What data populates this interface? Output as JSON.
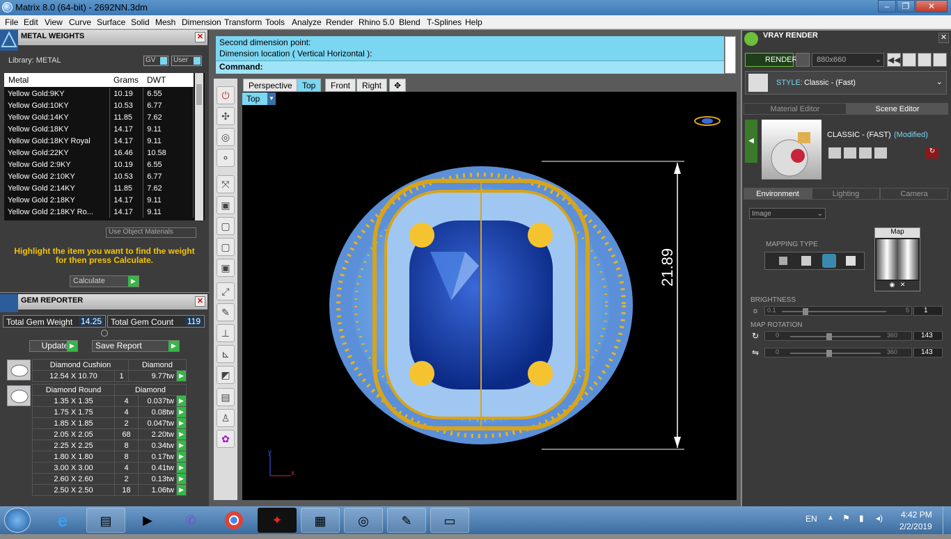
{
  "window": {
    "title": "Matrix 8.0 (64-bit) - 2692NN.3dm",
    "min": "–",
    "max": "❐",
    "close": "✕"
  },
  "menu": [
    "File",
    "Edit",
    "View",
    "Curve",
    "Surface",
    "Solid",
    "Mesh",
    "Dimension",
    "Transform",
    "Tools",
    "Analyze",
    "Render",
    "Rhino 5.0",
    "Blend",
    "T-Splines",
    "Help"
  ],
  "metal": {
    "header": "METAL WEIGHTS",
    "library": "Library: METAL",
    "gv": "GV",
    "user": "User",
    "columns": [
      "Metal",
      "Grams",
      "DWT"
    ],
    "rows": [
      [
        "Yellow Gold:9KY",
        "10.19",
        "6.55"
      ],
      [
        "Yellow Gold:10KY",
        "10.53",
        "6.77"
      ],
      [
        "Yellow Gold:14KY",
        "11.85",
        "7.62"
      ],
      [
        "Yellow Gold:18KY",
        "14.17",
        "9.11"
      ],
      [
        "Yellow Gold:18KY Royal",
        "14.17",
        "9.11"
      ],
      [
        "Yellow Gold:22KY",
        "16.46",
        "10.58"
      ],
      [
        "Yellow Gold 2:9KY",
        "10.19",
        "6.55"
      ],
      [
        "Yellow Gold 2:10KY",
        "10.53",
        "6.77"
      ],
      [
        "Yellow Gold 2:14KY",
        "11.85",
        "7.62"
      ],
      [
        "Yellow Gold 2:18KY",
        "14.17",
        "9.11"
      ],
      [
        "Yellow Gold 2:18KY Ro...",
        "14.17",
        "9.11"
      ]
    ],
    "use_object_materials": "Use Object Materials",
    "hint": "Highlight the item you want to find the weight for then press Calculate.",
    "calculate": "Calculate"
  },
  "gem": {
    "header": "GEM REPORTER",
    "total_weight_label": "Total Gem Weight",
    "total_weight": "14.25",
    "total_count_label": "Total Gem Count",
    "total_count": "119",
    "update": "Update",
    "save_report": "Save Report",
    "cushion": {
      "shape": "Diamond Cushion",
      "type": "Diamond",
      "size": "12.54 X 10.70",
      "count": "1",
      "weight": "9.77tw"
    },
    "round": {
      "shape": "Diamond Round",
      "type": "Diamond",
      "rows": [
        [
          "1.35 X 1.35",
          "4",
          "0.037tw"
        ],
        [
          "1.75 X 1.75",
          "4",
          "0.08tw"
        ],
        [
          "1.85 X 1.85",
          "2",
          "0.047tw"
        ],
        [
          "2.05 X 2.05",
          "68",
          "2.20tw"
        ],
        [
          "2.25 X 2.25",
          "8",
          "0.34tw"
        ],
        [
          "1.80 X 1.80",
          "8",
          "0.17tw"
        ],
        [
          "3.00 X 3.00",
          "4",
          "0.41tw"
        ],
        [
          "2.60 X 2.60",
          "2",
          "0.13tw"
        ],
        [
          "2.50 X 2.50",
          "18",
          "1.06tw"
        ]
      ]
    }
  },
  "command": {
    "line1": "Second dimension point:",
    "line2": "Dimension location ( Vertical  Horizontal ):",
    "prompt": "Command:"
  },
  "viewport": {
    "tabs": [
      "Perspective",
      "Top",
      "Front",
      "Right"
    ],
    "active_tab": "Top",
    "label": "Top",
    "dimension": "21.89",
    "axis_x": "x",
    "axis_y": "y"
  },
  "vray": {
    "header": "VRAY RENDER",
    "render": "RENDER",
    "resolution": "880x660",
    "style_label": "STYLE:",
    "style_value": "Classic - (Fast)",
    "tab_material": "Material Editor",
    "tab_scene": "Scene Editor",
    "preset": "CLASSIC - (FAST)",
    "modified": "(Modified)",
    "tab_env": "Environment",
    "tab_light": "Lighting",
    "tab_camera": "Camera",
    "env_type": "Image",
    "map_label": "Map",
    "mapping_type": "MAPPING TYPE",
    "brightness": "BRIGHTNESS",
    "b_min": "0.1",
    "b_max": "5",
    "b_val": "1",
    "map_rotation": "MAP ROTATION",
    "r1_min": "0",
    "r1_max": "360",
    "r1_val": "143",
    "r2_min": "0",
    "r2_max": "360",
    "r2_val": "143",
    "brightness_level": 0.2,
    "rotation_level": 0.4
  },
  "taskbar": {
    "lang": "EN",
    "time": "4:42 PM",
    "date": "2/2/2019"
  }
}
